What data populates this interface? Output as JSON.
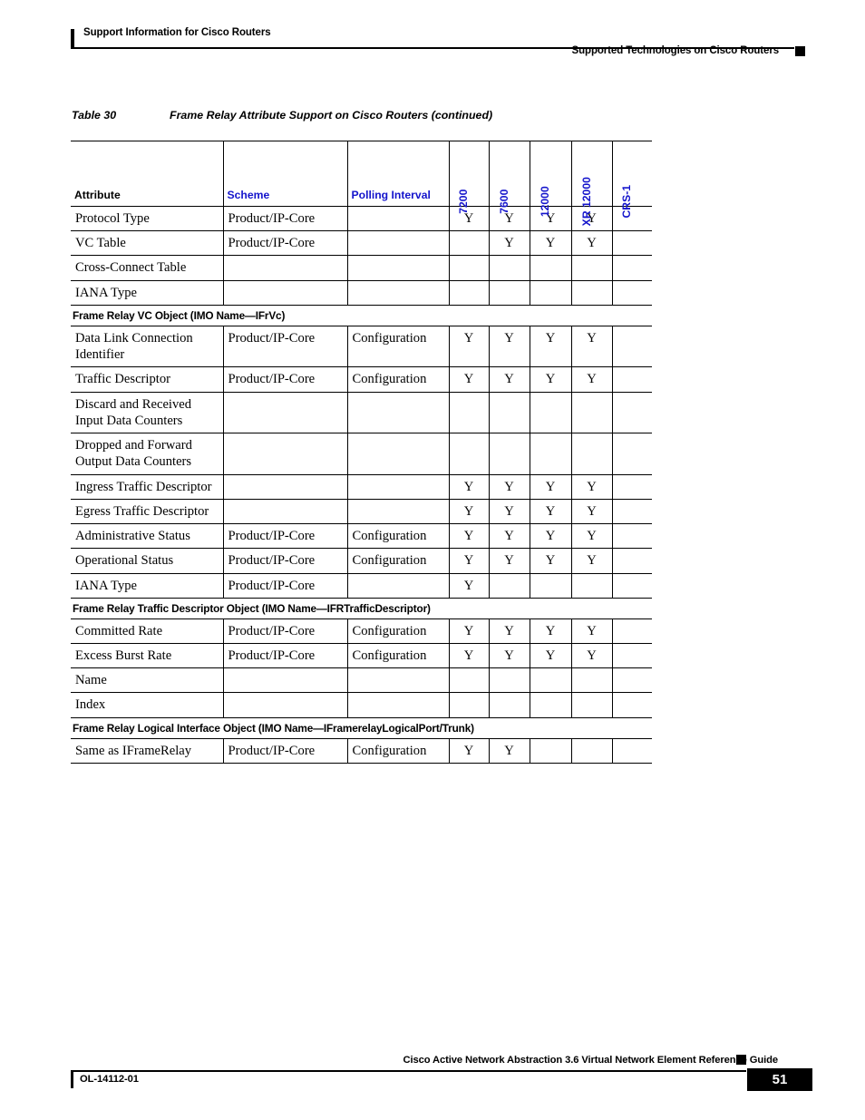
{
  "header": {
    "left_text": "Support Information for Cisco Routers",
    "right_text": "Supported Technologies on Cisco Routers"
  },
  "caption": {
    "number": "Table 30",
    "title": "Frame Relay Attribute Support on Cisco Routers (continued)"
  },
  "table": {
    "columns": [
      {
        "label": "Attribute",
        "rotated": false,
        "color": "#000000"
      },
      {
        "label": "Scheme",
        "rotated": false,
        "color": "#1414CC"
      },
      {
        "label": "Polling Interval",
        "rotated": false,
        "color": "#1414CC"
      },
      {
        "label": "7200",
        "rotated": true,
        "color": "#1414CC"
      },
      {
        "label": "7600",
        "rotated": true,
        "color": "#1414CC"
      },
      {
        "label": "12000",
        "rotated": true,
        "color": "#1414CC"
      },
      {
        "label": "XR 12000",
        "rotated": true,
        "color": "#1414CC"
      },
      {
        "label": "CRS-1",
        "rotated": true,
        "color": "#1414CC"
      }
    ],
    "rows": [
      {
        "kind": "data",
        "attribute": "Protocol Type",
        "scheme": "Product/IP-Core",
        "polling": "",
        "m7200": "Y",
        "m7600": "Y",
        "m12000": "Y",
        "mxr12000": "Y",
        "mcrs1": ""
      },
      {
        "kind": "data",
        "attribute": "VC Table",
        "scheme": "Product/IP-Core",
        "polling": "",
        "m7200": "",
        "m7600": "Y",
        "m12000": "Y",
        "mxr12000": "Y",
        "mcrs1": ""
      },
      {
        "kind": "data",
        "attribute": "Cross-Connect Table",
        "scheme": "",
        "polling": "",
        "m7200": "",
        "m7600": "",
        "m12000": "",
        "mxr12000": "",
        "mcrs1": ""
      },
      {
        "kind": "data",
        "attribute": "IANA Type",
        "scheme": "",
        "polling": "",
        "m7200": "",
        "m7600": "",
        "m12000": "",
        "mxr12000": "",
        "mcrs1": ""
      },
      {
        "kind": "section",
        "attribute": "Frame Relay VC Object (IMO Name—IFrVc)"
      },
      {
        "kind": "data",
        "attribute": "Data Link Connection Identifier",
        "scheme": "Product/IP-Core",
        "polling": "Configuration",
        "m7200": "Y",
        "m7600": "Y",
        "m12000": "Y",
        "mxr12000": "Y",
        "mcrs1": ""
      },
      {
        "kind": "data",
        "attribute": "Traffic Descriptor",
        "scheme": "Product/IP-Core",
        "polling": "Configuration",
        "m7200": "Y",
        "m7600": "Y",
        "m12000": "Y",
        "mxr12000": "Y",
        "mcrs1": ""
      },
      {
        "kind": "data",
        "attribute": "Discard and Received Input Data Counters",
        "scheme": "",
        "polling": "",
        "m7200": "",
        "m7600": "",
        "m12000": "",
        "mxr12000": "",
        "mcrs1": ""
      },
      {
        "kind": "data",
        "attribute": "Dropped and Forward Output Data Counters",
        "scheme": "",
        "polling": "",
        "m7200": "",
        "m7600": "",
        "m12000": "",
        "mxr12000": "",
        "mcrs1": ""
      },
      {
        "kind": "data",
        "attribute": "Ingress Traffic Descriptor",
        "scheme": "",
        "polling": "",
        "m7200": "Y",
        "m7600": "Y",
        "m12000": "Y",
        "mxr12000": "Y",
        "mcrs1": ""
      },
      {
        "kind": "data",
        "attribute": "Egress Traffic Descriptor",
        "scheme": "",
        "polling": "",
        "m7200": "Y",
        "m7600": "Y",
        "m12000": "Y",
        "mxr12000": "Y",
        "mcrs1": ""
      },
      {
        "kind": "data",
        "attribute": "Administrative Status",
        "scheme": "Product/IP-Core",
        "polling": "Configuration",
        "m7200": "Y",
        "m7600": "Y",
        "m12000": "Y",
        "mxr12000": "Y",
        "mcrs1": ""
      },
      {
        "kind": "data",
        "attribute": "Operational Status",
        "scheme": "Product/IP-Core",
        "polling": "Configuration",
        "m7200": "Y",
        "m7600": "Y",
        "m12000": "Y",
        "mxr12000": "Y",
        "mcrs1": ""
      },
      {
        "kind": "data",
        "attribute": "IANA Type",
        "scheme": "Product/IP-Core",
        "polling": "",
        "m7200": "Y",
        "m7600": "",
        "m12000": "",
        "mxr12000": "",
        "mcrs1": ""
      },
      {
        "kind": "section",
        "attribute": "Frame Relay Traffic Descriptor Object (IMO Name—IFRTrafficDescriptor)"
      },
      {
        "kind": "data",
        "attribute": "Committed Rate",
        "scheme": "Product/IP-Core",
        "polling": "Configuration",
        "m7200": "Y",
        "m7600": "Y",
        "m12000": "Y",
        "mxr12000": "Y",
        "mcrs1": ""
      },
      {
        "kind": "data",
        "attribute": "Excess Burst Rate",
        "scheme": "Product/IP-Core",
        "polling": "Configuration",
        "m7200": "Y",
        "m7600": "Y",
        "m12000": "Y",
        "mxr12000": "Y",
        "mcrs1": ""
      },
      {
        "kind": "data",
        "attribute": "Name",
        "scheme": "",
        "polling": "",
        "m7200": "",
        "m7600": "",
        "m12000": "",
        "mxr12000": "",
        "mcrs1": ""
      },
      {
        "kind": "data",
        "attribute": "Index",
        "scheme": "",
        "polling": "",
        "m7200": "",
        "m7600": "",
        "m12000": "",
        "mxr12000": "",
        "mcrs1": ""
      },
      {
        "kind": "section",
        "attribute": "Frame Relay Logical Interface Object (IMO Name—IFramerelayLogicalPort/Trunk)"
      },
      {
        "kind": "data",
        "attribute": "Same as IFrameRelay",
        "scheme": "Product/IP-Core",
        "polling": "Configuration",
        "m7200": "Y",
        "m7600": "Y",
        "m12000": "",
        "mxr12000": "",
        "mcrs1": ""
      }
    ]
  },
  "footer": {
    "guide_title": "Cisco Active Network Abstraction 3.6 Virtual Network Element Reference Guide",
    "doc_number": "OL-14112-01",
    "page_number": "51"
  }
}
